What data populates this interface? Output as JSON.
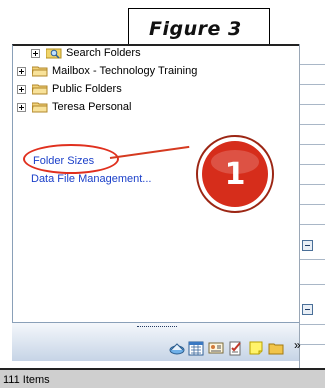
{
  "figure": {
    "label": "Figure 3"
  },
  "folder_tree": {
    "items": [
      {
        "label": "Search Folders",
        "icon": "search-folder-icon"
      },
      {
        "label": "Mailbox - Technology Training",
        "icon": "folder-icon"
      },
      {
        "label": "Public Folders",
        "icon": "folder-icon"
      },
      {
        "label": "Teresa Personal",
        "icon": "folder-icon"
      }
    ]
  },
  "links": {
    "folder_sizes": "Folder Sizes",
    "data_file_management": "Data File Management..."
  },
  "callout": {
    "number": "1"
  },
  "nav_icons": [
    "mail-icon",
    "calendar-icon",
    "contacts-icon",
    "tasks-icon",
    "notes-icon",
    "folder-list-icon",
    "configure-buttons-icon"
  ],
  "statusbar": {
    "text": "111 Items"
  },
  "colors": {
    "callout_red": "#e0301e",
    "badge_fill": "#d62d1b",
    "link_blue": "#1a3fc9"
  }
}
